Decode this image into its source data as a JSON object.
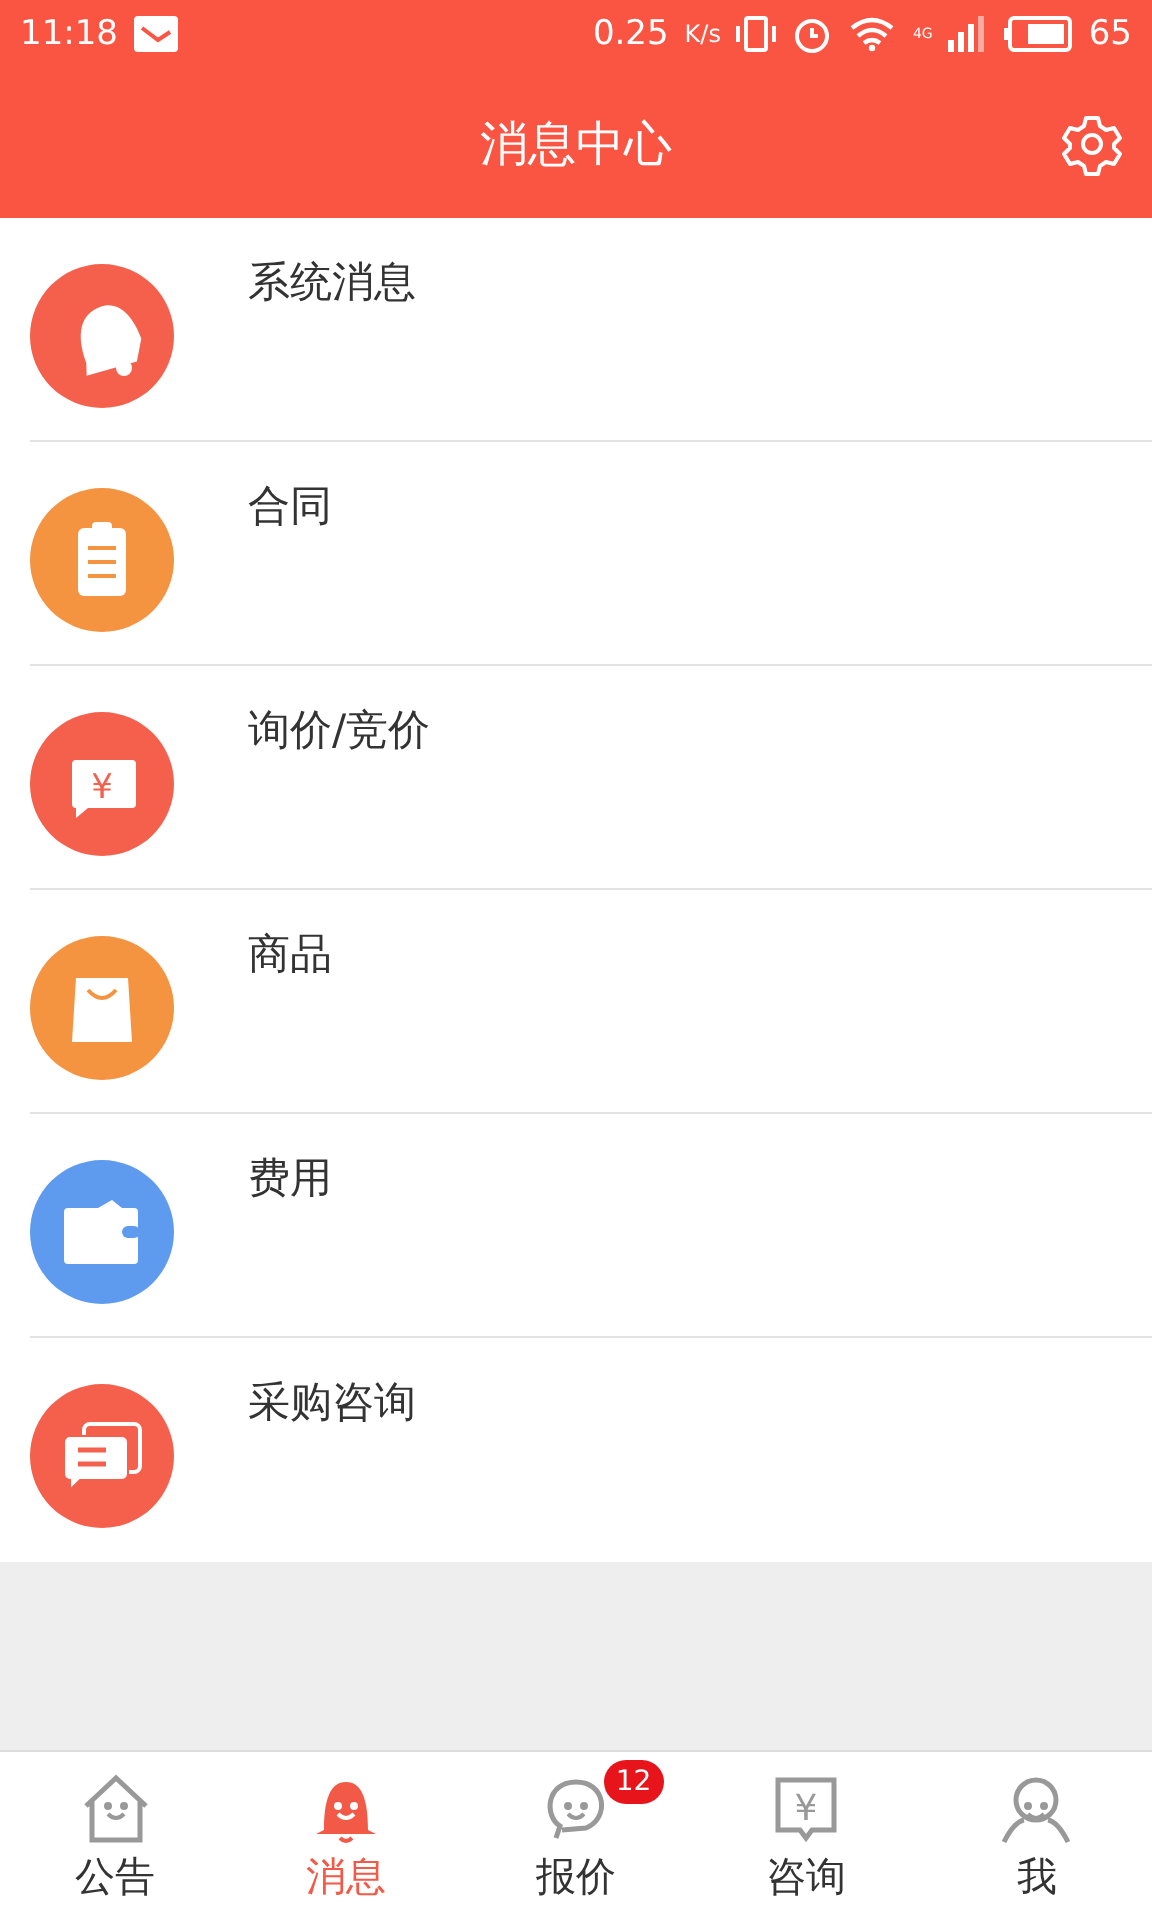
{
  "status_bar": {
    "time": "11:18",
    "speed": "0.25",
    "speed_unit": "K/s",
    "network": "4G",
    "battery": "65"
  },
  "header": {
    "title": "消息中心"
  },
  "items": [
    {
      "kind": "bell",
      "label": "系统消息",
      "color": "#f4604c"
    },
    {
      "kind": "clipboard",
      "label": "合同",
      "color": "#f59440"
    },
    {
      "kind": "price",
      "label": "询价/竞价",
      "glyph": "¥",
      "color": "#f4604c"
    },
    {
      "kind": "bag",
      "label": "商品",
      "color": "#f59440"
    },
    {
      "kind": "wallet",
      "label": "费用",
      "color": "#5e9bef"
    },
    {
      "kind": "chat",
      "label": "采购咨询",
      "color": "#f4604c"
    }
  ],
  "tabs": [
    {
      "kind": "home",
      "label": "公告",
      "selected": false
    },
    {
      "kind": "bell",
      "label": "消息",
      "selected": true
    },
    {
      "kind": "quote",
      "label": "报价",
      "selected": false,
      "badge": "12"
    },
    {
      "kind": "consult",
      "label": "咨询",
      "glyph": "¥",
      "selected": false
    },
    {
      "kind": "me",
      "label": "我",
      "selected": false
    }
  ]
}
